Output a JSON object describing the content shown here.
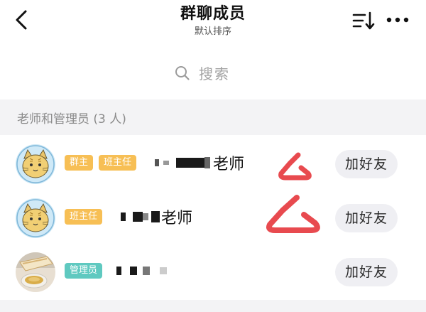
{
  "header": {
    "title": "群聊成员",
    "subtitle": "默认排序",
    "back_icon": "chevron-left-icon",
    "sort_icon": "sort-icon",
    "more_icon": "more-dots-icon"
  },
  "search": {
    "placeholder": "搜索",
    "icon": "search-icon"
  },
  "section": {
    "label": "老师和管理员 (3 人)"
  },
  "members": [
    {
      "badges": [
        "群主",
        "班主任"
      ],
      "name_suffix": "老师",
      "button": "加好友",
      "avatar": "cat-avatar"
    },
    {
      "badges": [
        "班主任"
      ],
      "name_suffix": "老师",
      "button": "加好友",
      "avatar": "cat-avatar"
    },
    {
      "badges": [
        "管理员"
      ],
      "name_suffix": "",
      "button": "加好友",
      "avatar": "food-photo-avatar"
    }
  ],
  "colors": {
    "badge_orange": "#f7bf55",
    "badge_teal": "#5fc9c0",
    "mark_red": "#e84a4f",
    "section_bg": "#f3f3f5",
    "button_bg": "#efeff3"
  }
}
